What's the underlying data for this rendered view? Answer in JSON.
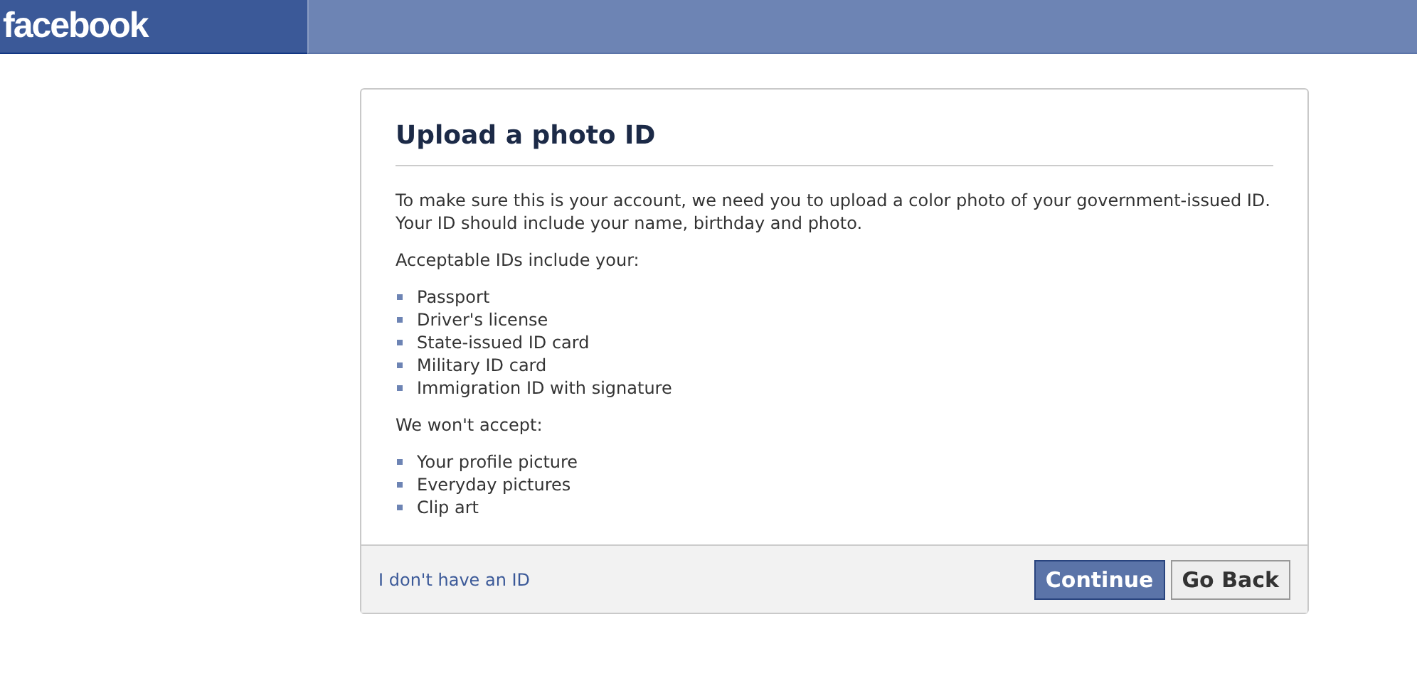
{
  "header": {
    "logo": "facebook"
  },
  "dialog": {
    "title": "Upload a photo ID",
    "intro": "To make sure this is your account, we need you to upload a color photo of your government-issued ID. Your ID should include your name, birthday and photo.",
    "sections": [
      {
        "heading": "Acceptable IDs include your:",
        "items": [
          "Passport",
          "Driver's license",
          "State-issued ID card",
          "Military ID card",
          "Immigration ID with signature"
        ]
      },
      {
        "heading": "We won't accept:",
        "items": [
          "Your profile picture",
          "Everyday pictures",
          "Clip art"
        ]
      }
    ],
    "footer_link": "I don't have an ID",
    "buttons": [
      {
        "label": "Continue",
        "kind": "primary"
      },
      {
        "label": "Go Back",
        "kind": "secondary"
      }
    ]
  }
}
